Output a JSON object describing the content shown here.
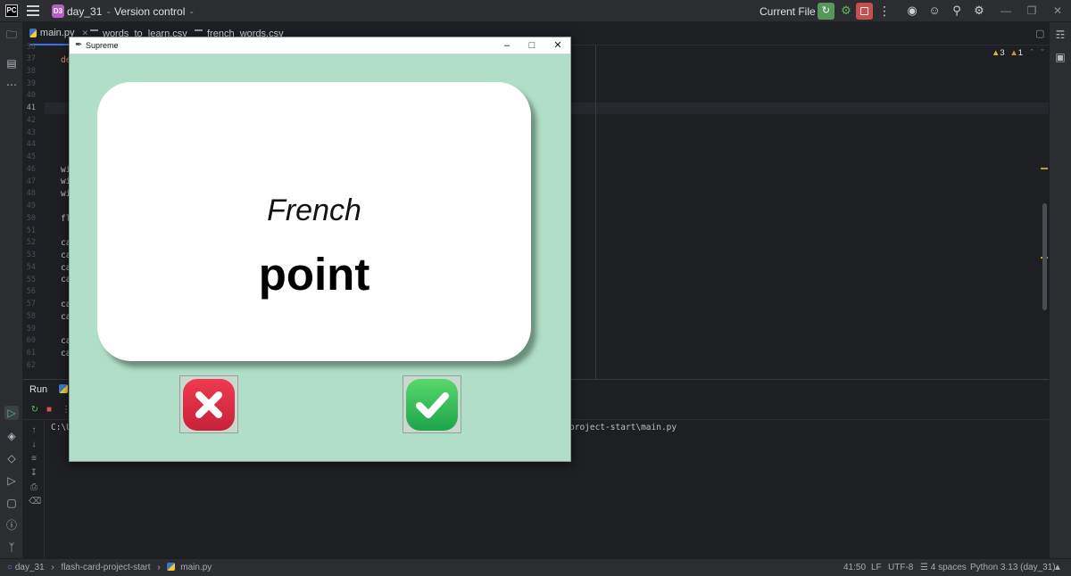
{
  "header": {
    "project_badge": "D3",
    "project_name": "day_31",
    "version_control": "Version control",
    "run_config": "Current File"
  },
  "tabs": [
    {
      "label": "main.py"
    },
    {
      "label": "words_to_learn.csv"
    },
    {
      "label": "french_words.csv"
    }
  ],
  "editor": {
    "line_numbers": [
      "36",
      "37",
      "38",
      "39",
      "40",
      "41",
      "42",
      "43",
      "44",
      "45",
      "46",
      "47",
      "48",
      "49",
      "50",
      "51",
      "52",
      "53",
      "54",
      "55",
      "56",
      "57",
      "58",
      "59",
      "60",
      "61",
      "62"
    ],
    "current_line": "41",
    "code_fragments": [
      "de",
      "wi",
      "wi",
      "wi",
      "fl",
      "ca",
      "ca",
      "ca",
      "ca",
      "ca",
      "ca",
      "ca",
      "ca"
    ],
    "warnings_count": "3",
    "weak_warnings_count": "1"
  },
  "run_panel": {
    "title": "Run",
    "console_line_start": "C:\\U",
    "console_line_end": "project-start\\main.py"
  },
  "tk_window": {
    "title": "Supreme",
    "card_language": "French",
    "card_word": "point",
    "background_color": "#b1dec8"
  },
  "statusbar": {
    "breadcrumb": [
      "day_31",
      "flash-card-project-start",
      "main.py"
    ],
    "position": "41:50",
    "line_ending": "LF",
    "encoding": "UTF-8",
    "indent": "4 spaces",
    "interpreter": "Python 3.13 (day_31)"
  }
}
